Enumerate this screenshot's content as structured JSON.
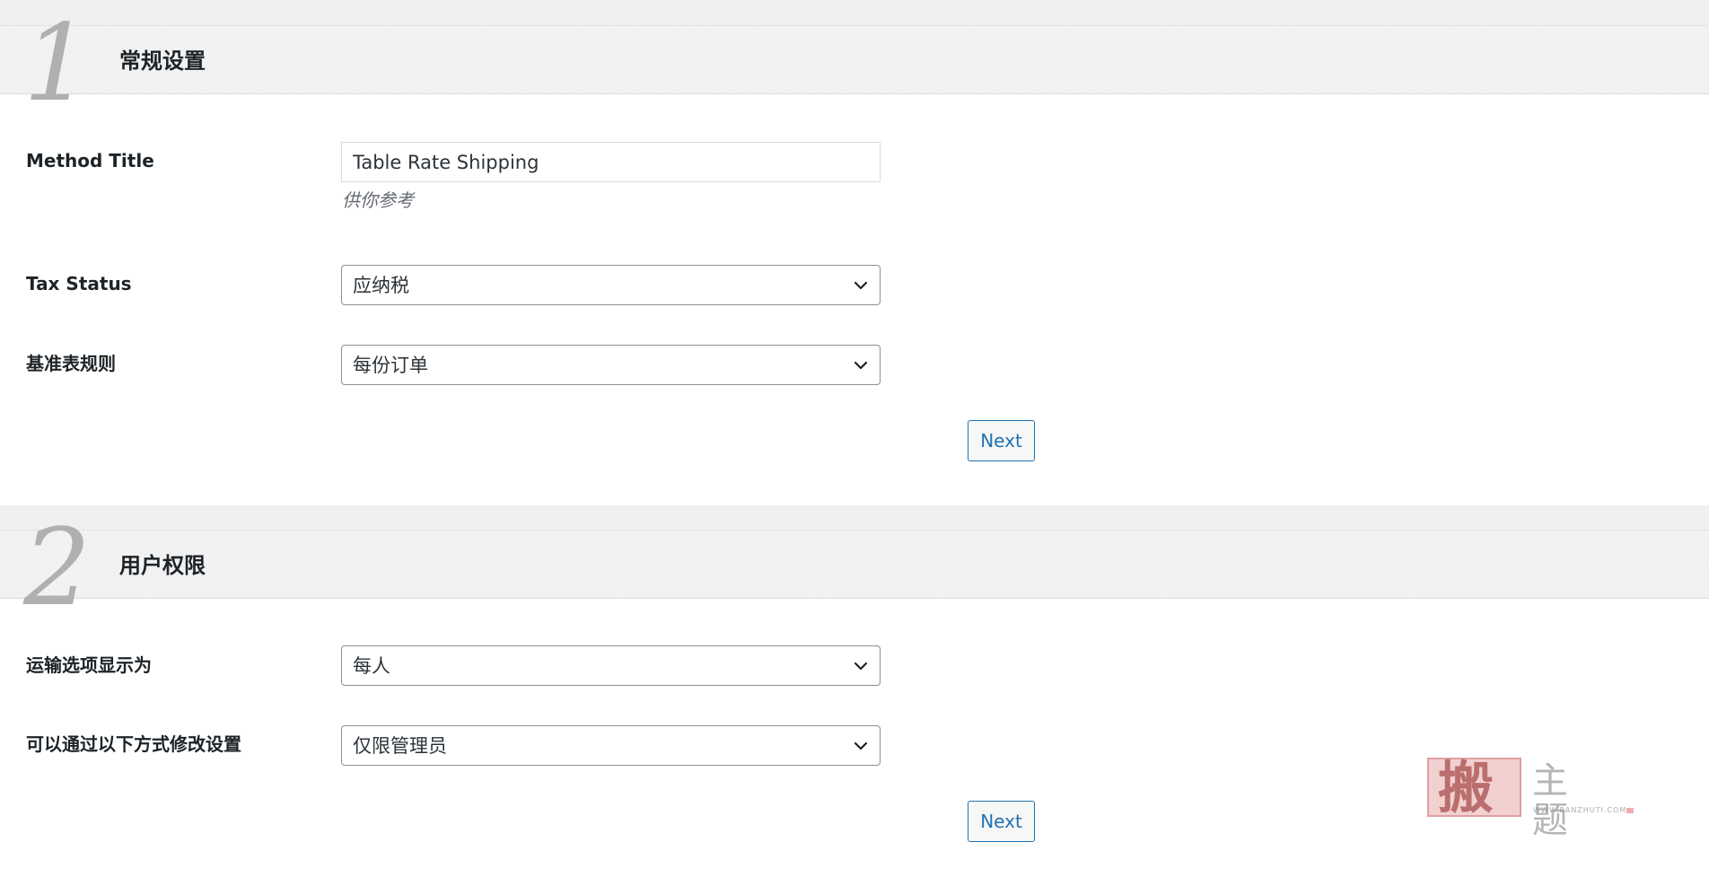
{
  "section1": {
    "number": "1",
    "title": "常规设置",
    "method_title": {
      "label": "Method Title",
      "value": "Table Rate Shipping",
      "hint": "供你参考"
    },
    "tax_status": {
      "label": "Tax Status",
      "value": "应纳税"
    },
    "base_rule": {
      "label": "基准表规则",
      "value": "每份订单"
    },
    "next_label": "Next"
  },
  "section2": {
    "number": "2",
    "title": "用户权限",
    "shipping_display": {
      "label": "运输选项显示为",
      "value": "每人"
    },
    "modify_settings": {
      "label": "可以通过以下方式修改设置",
      "value": "仅限管理员"
    },
    "next_label": "Next"
  },
  "watermark": {
    "glyph": "搬",
    "title": "主题",
    "url": "WWW.BANZHUTI.COM"
  },
  "icons": {
    "select_arrow": "chevron-down-icon"
  },
  "colors": {
    "accent": "#2271b1",
    "header_bg": "#f3f3f4",
    "step_number": "#b0b0b0"
  }
}
